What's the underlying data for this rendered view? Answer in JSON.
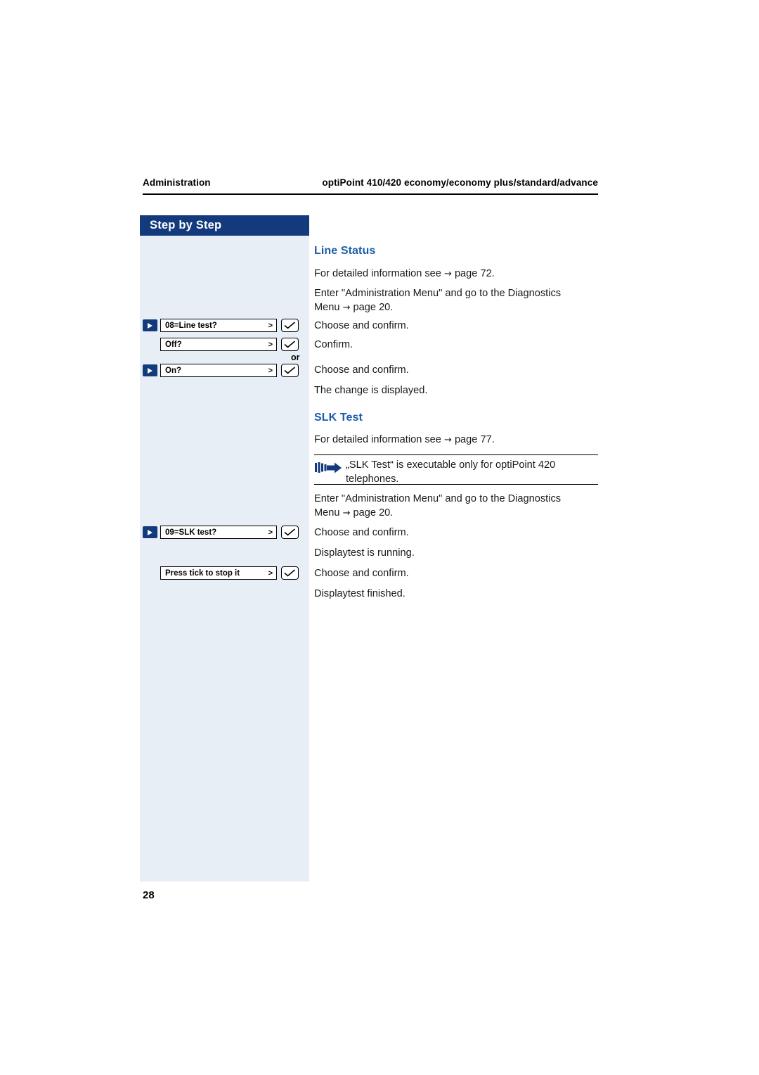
{
  "header": {
    "left": "Administration",
    "right": "optiPoint 410/420 economy/economy plus/standard/advance"
  },
  "sidebar": {
    "banner": "Step by Step",
    "or_label": "or",
    "keys": [
      {
        "display": "08=Line test?",
        "chevron": ">",
        "has_bullet": true,
        "has_tick": true
      },
      {
        "display": "Off?",
        "chevron": ">",
        "has_bullet": false,
        "has_tick": true
      },
      {
        "display": "On?",
        "chevron": ">",
        "has_bullet": true,
        "has_tick": true
      },
      {
        "display": "09=SLK test?",
        "chevron": ">",
        "has_bullet": true,
        "has_tick": true
      },
      {
        "display": "Press tick to stop it",
        "chevron": ">",
        "has_bullet": false,
        "has_tick": true
      }
    ]
  },
  "content": {
    "section1_title": "Line Status",
    "line1": "For detailed information see",
    "line1_arrow": "→",
    "line1_page": "page  72.",
    "line2a": "Enter \"Administration Menu\" and go to the Diagnostics",
    "line2b": "Menu",
    "line2b_arrow": "→",
    "line2b_page": "page  20.",
    "line3": "Choose and confirm.",
    "line4": "Confirm.",
    "line5": "Choose and confirm.",
    "line6": "The change is displayed.",
    "section2_title": "SLK Test",
    "line7": "For detailed information see",
    "line7_arrow": "→",
    "line7_page": "page  77.",
    "note_line1": "„SLK Test“ is executable only for optiPoint 420",
    "note_line2": "telephones.",
    "line8a": "Enter \"Administration Menu\" and go to the Diagnostics",
    "line8b": "Menu",
    "line8b_arrow": "→",
    "line8b_page": "page  20.",
    "line9": "Choose and confirm.",
    "line10": "Displaytest is running.",
    "line11": "Choose and confirm.",
    "line12": "Displaytest finished."
  },
  "footer": {
    "page_number": "28"
  },
  "colors": {
    "banner_blue": "#123a7c",
    "sidebar_bg": "#e8eef6",
    "heading_blue": "#1a5ca8"
  }
}
